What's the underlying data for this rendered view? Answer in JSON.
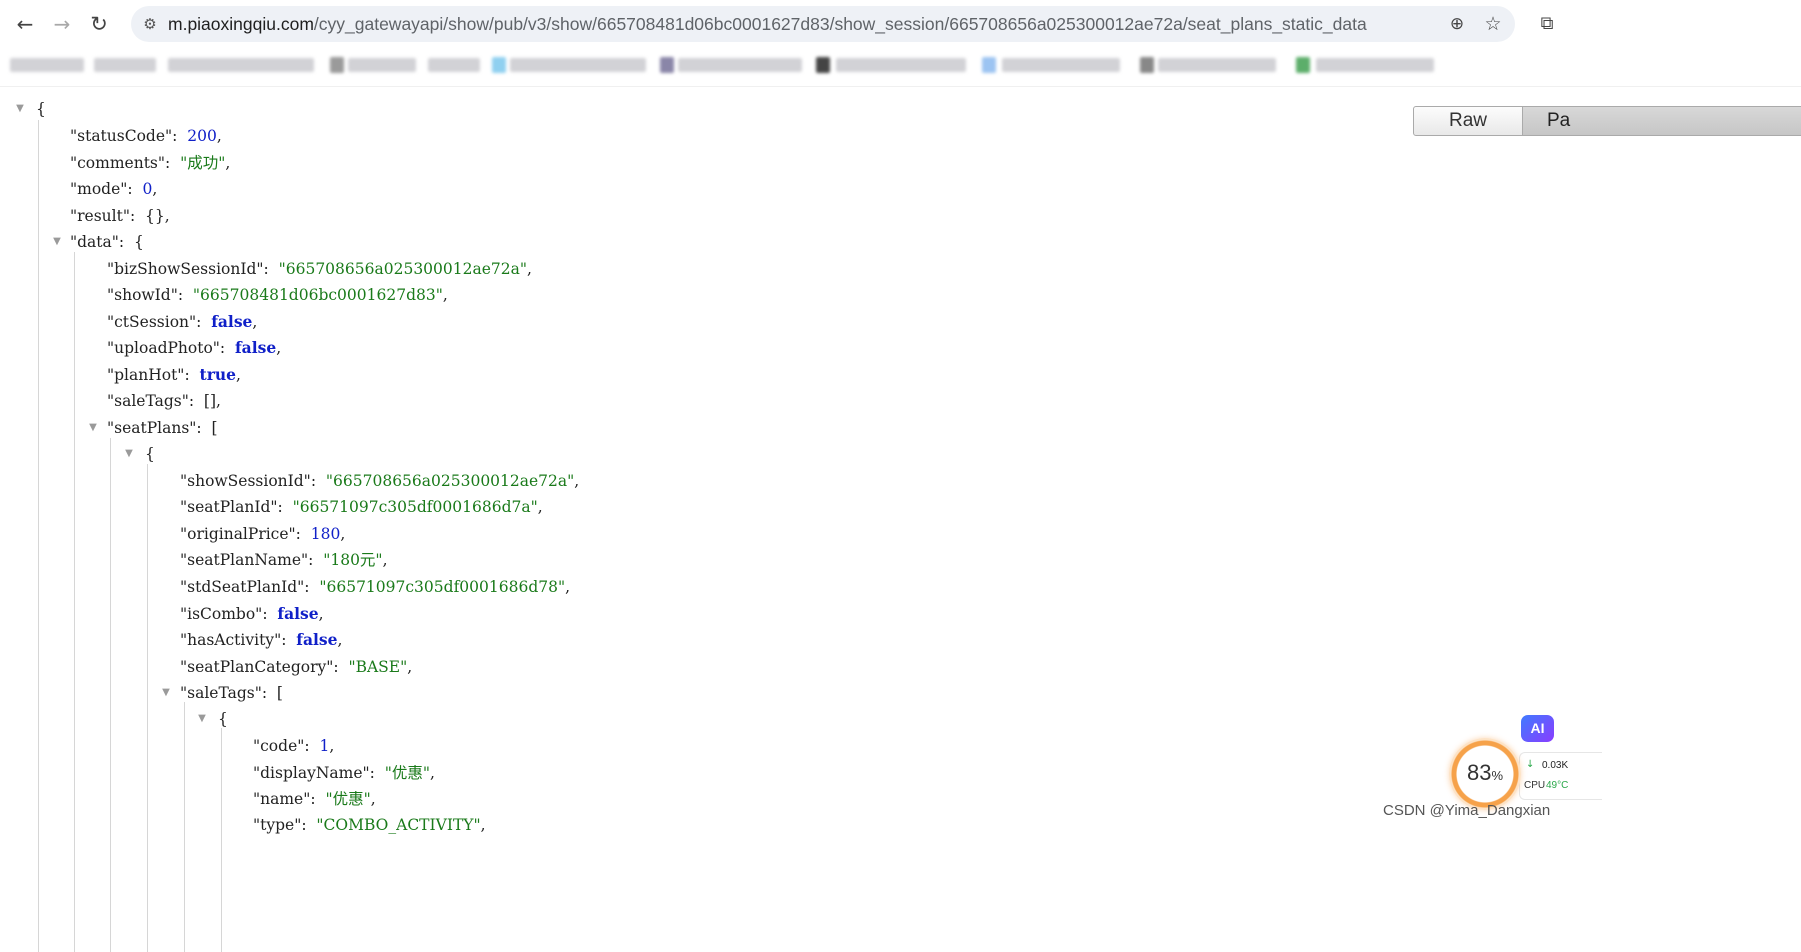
{
  "browser": {
    "url_host": "m.piaoxingqiu.com",
    "url_path": "/cyy_gatewayapi/show/pub/v3/show/665708481d06bc0001627d83/show_session/665708656a025300012ae72a/seat_plans_static_data"
  },
  "viewer": {
    "raw_label": "Raw",
    "parsed_label": "Pa"
  },
  "json": {
    "statusCode": "200",
    "comments": "\"成功\"",
    "mode": "0",
    "result": "{}",
    "data": {
      "bizShowSessionId": "\"665708656a025300012ae72a\"",
      "showId": "\"665708481d06bc0001627d83\"",
      "ctSession": "false",
      "uploadPhoto": "false",
      "planHot": "true",
      "saleTags": "[]",
      "seatPlan0": {
        "showSessionId": "\"665708656a025300012ae72a\"",
        "seatPlanId": "\"66571097c305df0001686d7a\"",
        "originalPrice": "180",
        "seatPlanName": "\"180元\"",
        "stdSeatPlanId": "\"66571097c305df0001686d78\"",
        "isCombo": "false",
        "hasActivity": "false",
        "seatPlanCategory": "\"BASE\"",
        "saleTag0": {
          "code": "1",
          "displayName": "\"优惠\"",
          "name": "\"优惠\"",
          "type": "\"COMBO_ACTIVITY\""
        }
      }
    }
  },
  "widgets": {
    "ai_label": "AI",
    "perf_percent": "83",
    "perf_unit": "%",
    "net_speed": "0.03K",
    "cpu_label": "CPU",
    "cpu_value": "49°C"
  },
  "watermark": "CSDN @Yima_Dangxian"
}
